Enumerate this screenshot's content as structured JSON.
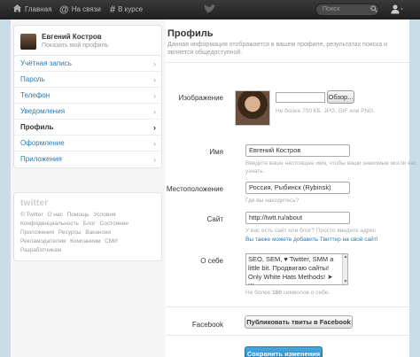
{
  "topbar": {
    "home": "Главная",
    "connect": "На связи",
    "discover": "В курсе",
    "search_placeholder": "Поиск",
    "icons": {
      "home": "home-icon",
      "connect": "at-icon",
      "discover": "hash-icon",
      "bird": "twitter-bird-icon",
      "search": "search-icon",
      "user": "user-icon"
    }
  },
  "sidebar": {
    "name": "Евгений Костров",
    "subtitle": "Показать мой профиль",
    "items": [
      {
        "label": "Учётная запись"
      },
      {
        "label": "Пароль"
      },
      {
        "label": "Телефон"
      },
      {
        "label": "Уведомления"
      },
      {
        "label": "Профиль"
      },
      {
        "label": "Оформление"
      },
      {
        "label": "Приложения"
      }
    ],
    "footer_logo": "twitter",
    "footer_links": [
      "© Twitter",
      "О нас",
      "Помощь",
      "Условия",
      "Конфиденциальность",
      "Блог",
      "Состояние",
      "Приложения",
      "Ресурсы",
      "Вакансии",
      "Рекламодателям",
      "Компаниям",
      "СМИ",
      "Разработчикам"
    ]
  },
  "main": {
    "title": "Профиль",
    "description": "Данная информация отображается в вашем профиле, результатах поиска и является общедоступной.",
    "image_label": "Изображение",
    "browse_button": "Обзор...",
    "image_hint": "Не более 700 КБ. JPG, GIF или PNG.",
    "name_label": "Имя",
    "name_value": "Евгений Костров",
    "name_hint_1": "Введите ваше настоящее имя, чтобы ваши знакомые могли вас",
    "name_hint_2": "узнать.",
    "location_label": "Местоположение",
    "location_value": "Россия, Рыбинск (Rybinsk)",
    "location_hint": "Где вы находитесь?",
    "site_label": "Сайт",
    "site_value": "http://twtt.ru/about",
    "site_hint": "У вас есть сайт или блог? Просто введите адрес",
    "site_link": "Вы также можете добавить Твиттер на свой сайт!",
    "bio_label": "О себе",
    "bio_value": "SEO, SEM, ♥ Twitter, SMM а little bit. Продвигаю сайты! Only White Hats Methods! ➤ Живу в",
    "bio_hint_pre": "Не более ",
    "bio_hint_count": "160",
    "bio_hint_post": " символов о себе.",
    "facebook_label": "Facebook",
    "facebook_button": "Публиковать твиты в Facebook",
    "save_button": "Сохранить изменения"
  },
  "colors": {
    "accent": "#2a7ab0",
    "save": "#1f86c4",
    "topbar": "#2a2a2a"
  }
}
